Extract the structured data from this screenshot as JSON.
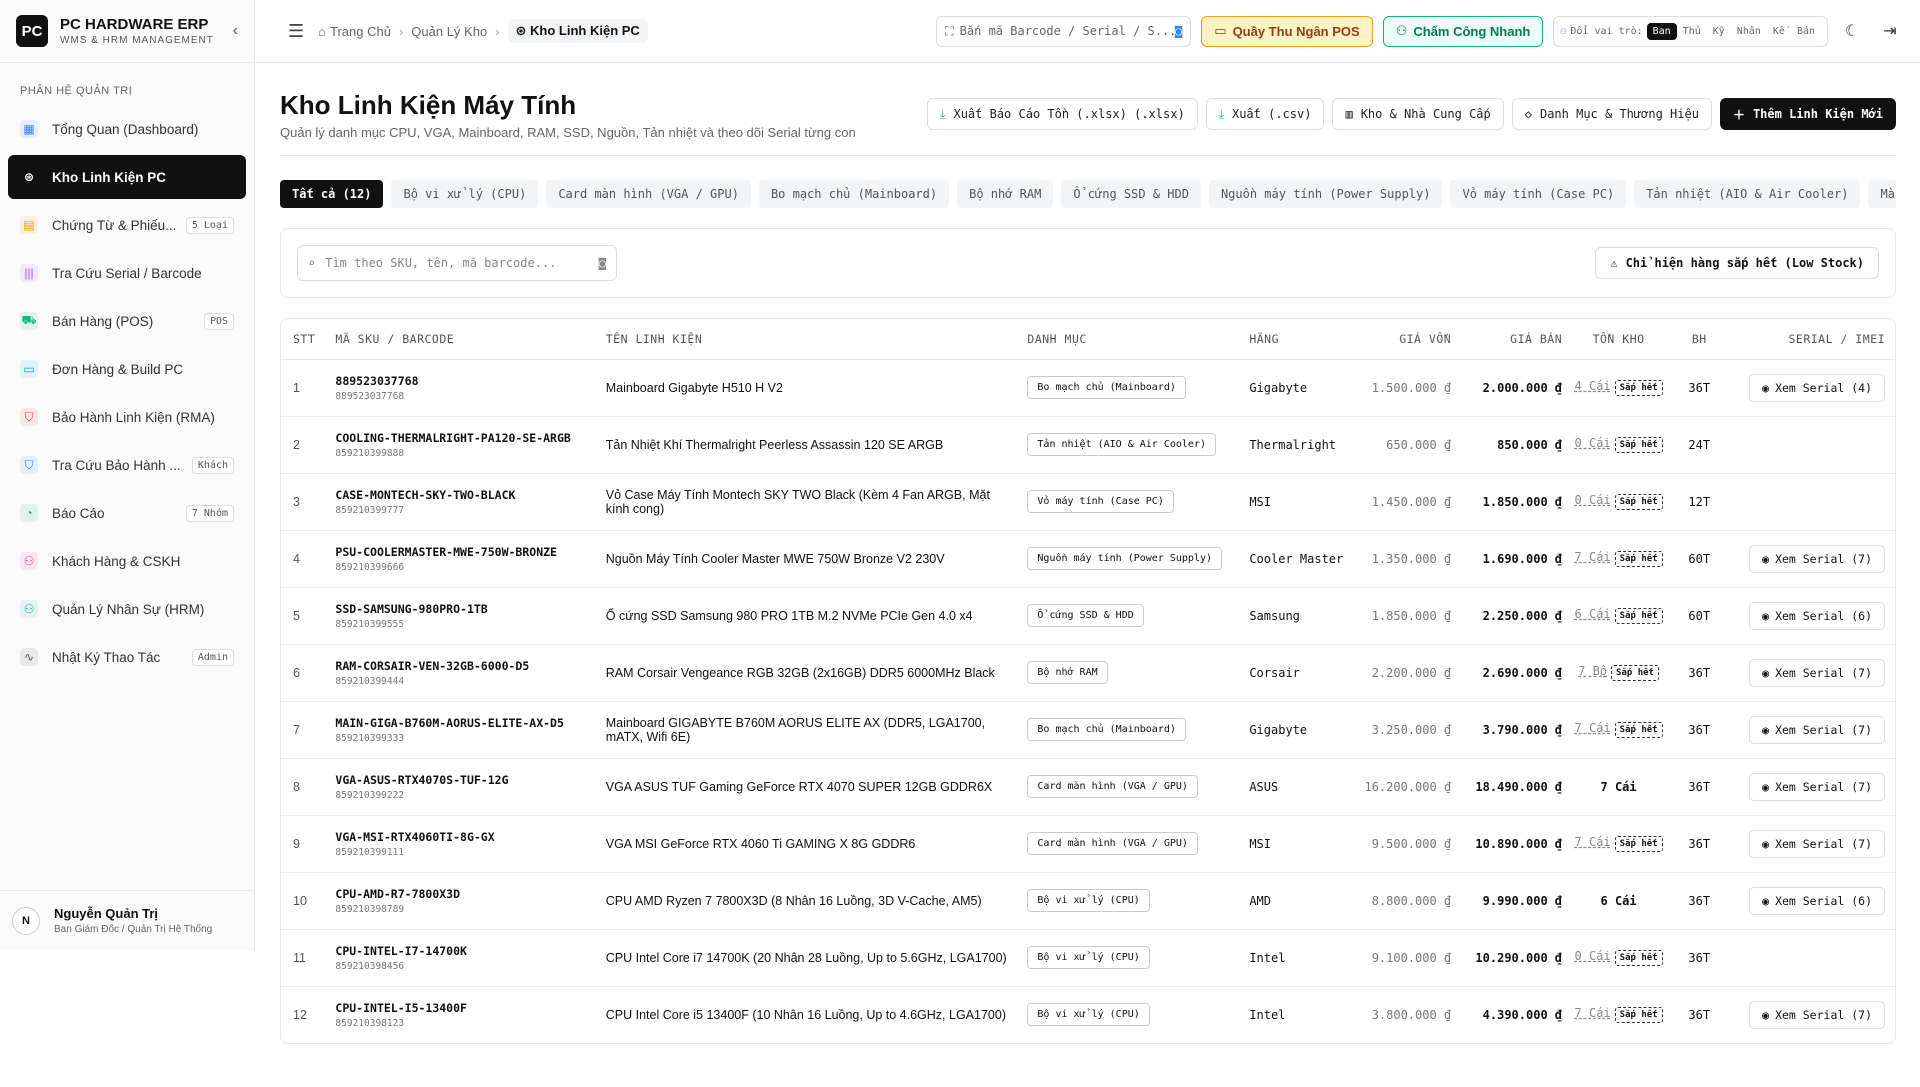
{
  "brand": {
    "logo": "PC",
    "name": "PC HARDWARE ERP",
    "sub": "WMS & HRM MANAGEMENT"
  },
  "sidebar": {
    "section": "PHÂN HỆ QUẢN TRỊ",
    "items": [
      {
        "label": "Tổng Quan (Dashboard)",
        "icon": "▦",
        "color": "#3b82f6",
        "badge": ""
      },
      {
        "label": "Kho Linh Kiện PC",
        "icon": "⊛",
        "color": "#ffffff",
        "badge": ""
      },
      {
        "label": "Chứng Từ & Phiếu...",
        "icon": "▤",
        "color": "#f59e0b",
        "badge": "5 Loại"
      },
      {
        "label": "Tra Cứu Serial / Barcode",
        "icon": "|||",
        "color": "#a855f7",
        "badge": ""
      },
      {
        "label": "Bán Hàng (POS)",
        "icon": "⛟",
        "color": "#10b981",
        "badge": "POS"
      },
      {
        "label": "Đơn Hàng & Build PC",
        "icon": "▭",
        "color": "#06b6d4",
        "badge": ""
      },
      {
        "label": "Bảo Hành Linh Kiện (RMA)",
        "icon": "⛉",
        "color": "#ef4444",
        "badge": ""
      },
      {
        "label": "Tra Cứu Bảo Hành ...",
        "icon": "⛉",
        "color": "#3b82f6",
        "badge": "Khách"
      },
      {
        "label": "Báo Cáo",
        "icon": "◔",
        "color": "#10b981",
        "badge": "7 Nhóm"
      },
      {
        "label": "Khách Hàng & CSKH",
        "icon": "⚇",
        "color": "#ec4899",
        "badge": ""
      },
      {
        "label": "Quản Lý Nhân Sự (HRM)",
        "icon": "⚇",
        "color": "#14b8a6",
        "badge": ""
      },
      {
        "label": "Nhật Ký Thao Tác",
        "icon": "∿",
        "color": "#555555",
        "badge": "Admin"
      }
    ]
  },
  "user": {
    "initial": "N",
    "name": "Nguyễn Quản Trị",
    "role": "Ban Giám Đốc / Quản Trị Hệ Thống"
  },
  "topbar": {
    "breadcrumb": [
      "Trang Chủ",
      "Quản Lý Kho",
      "Kho Linh Kiện PC"
    ],
    "barcode_placeholder": "Bắn mã Barcode / Serial / S...",
    "pos_label": "Quầy Thu Ngân POS",
    "attendance_label": "Chấm Công Nhanh",
    "role_label": "Đổi vai trò:",
    "roles": [
      "Ban",
      "Thủ",
      "Kỹ",
      "Nhân",
      "Kế",
      "Bán"
    ]
  },
  "page": {
    "title": "Kho Linh Kiện Máy Tính",
    "subtitle": "Quản lý danh mục CPU, VGA, Mainboard, RAM, SSD, Nguồn, Tản nhiệt và theo dõi Serial từng con",
    "actions": [
      "Xuất Báo Cáo Tồn (.xlsx) (.xlsx)",
      "Xuất (.csv)",
      "Kho & Nhà Cung Cấp",
      "Danh Mục & Thương Hiệu",
      "Thêm Linh Kiện Mới"
    ]
  },
  "tabs": [
    "Tất cả (12)",
    "Bộ vi xử lý (CPU)",
    "Card màn hình (VGA / GPU)",
    "Bo mạch chủ (Mainboard)",
    "Bộ nhớ RAM",
    "Ổ cứng SSD & HDD",
    "Nguồn máy tính (Power Supply)",
    "Vỏ máy tính (Case PC)",
    "Tản nhiệt (AIO & Air Cooler)",
    "Màn hình"
  ],
  "filter": {
    "search_placeholder": "Tìm theo SKU, tên, mã barcode...",
    "low_stock_label": "Chỉ hiện hàng sắp hết (Low Stock)"
  },
  "table": {
    "headers": [
      "STT",
      "MÃ SKU / BARCODE",
      "TÊN LINH KIỆN",
      "DANH MỤC",
      "HÃNG",
      "GIÁ VỐN",
      "GIÁ BÁN",
      "TỒN KHO",
      "BH",
      "SERIAL / IMEI"
    ],
    "low_tag": "Sắp hết",
    "rows": [
      {
        "stt": "1",
        "sku": "889523037768",
        "barcode": "889523037768",
        "name": "Mainboard Gigabyte H510 H V2",
        "cat": "Bo mạch chủ (Mainboard)",
        "brand": "Gigabyte",
        "cost": "1.500.000 ₫",
        "price": "2.000.000 ₫",
        "stock": "4 Cái",
        "low": true,
        "bh": "36T",
        "serial": "Xem Serial (4)"
      },
      {
        "stt": "2",
        "sku": "COOLING-THERMALRIGHT-PA120-SE-ARGB",
        "barcode": "859210399888",
        "name": "Tản Nhiệt Khí Thermalright Peerless Assassin 120 SE ARGB",
        "cat": "Tản nhiệt (AIO & Air Cooler)",
        "brand": "Thermalright",
        "cost": "650.000 ₫",
        "price": "850.000 ₫",
        "stock": "0 Cái",
        "low": true,
        "bh": "24T",
        "serial": ""
      },
      {
        "stt": "3",
        "sku": "CASE-MONTECH-SKY-TWO-BLACK",
        "barcode": "859210399777",
        "name": "Vỏ Case Máy Tính Montech SKY TWO Black (Kèm 4 Fan ARGB, Mặt kính cong)",
        "cat": "Vỏ máy tính (Case PC)",
        "brand": "MSI",
        "cost": "1.450.000 ₫",
        "price": "1.850.000 ₫",
        "stock": "0 Cái",
        "low": true,
        "bh": "12T",
        "serial": ""
      },
      {
        "stt": "4",
        "sku": "PSU-COOLERMASTER-MWE-750W-BRONZE",
        "barcode": "859210399666",
        "name": "Nguồn Máy Tính Cooler Master MWE 750W Bronze V2 230V",
        "cat": "Nguồn máy tính (Power Supply)",
        "brand": "Cooler Master",
        "cost": "1.350.000 ₫",
        "price": "1.690.000 ₫",
        "stock": "7 Cái",
        "low": true,
        "bh": "60T",
        "serial": "Xem Serial (7)"
      },
      {
        "stt": "5",
        "sku": "SSD-SAMSUNG-980PRO-1TB",
        "barcode": "859210399555",
        "name": "Ổ cứng SSD Samsung 980 PRO 1TB M.2 NVMe PCIe Gen 4.0 x4",
        "cat": "Ổ cứng SSD & HDD",
        "brand": "Samsung",
        "cost": "1.850.000 ₫",
        "price": "2.250.000 ₫",
        "stock": "6 Cái",
        "low": true,
        "bh": "60T",
        "serial": "Xem Serial (6)"
      },
      {
        "stt": "6",
        "sku": "RAM-CORSAIR-VEN-32GB-6000-D5",
        "barcode": "859210399444",
        "name": "RAM Corsair Vengeance RGB 32GB (2x16GB) DDR5 6000MHz Black",
        "cat": "Bộ nhớ RAM",
        "brand": "Corsair",
        "cost": "2.200.000 ₫",
        "price": "2.690.000 ₫",
        "stock": "7 Bộ",
        "low": true,
        "bh": "36T",
        "serial": "Xem Serial (7)"
      },
      {
        "stt": "7",
        "sku": "MAIN-GIGA-B760M-AORUS-ELITE-AX-D5",
        "barcode": "859210399333",
        "name": "Mainboard GIGABYTE B760M AORUS ELITE AX (DDR5, LGA1700, mATX, Wifi 6E)",
        "cat": "Bo mạch chủ (Mainboard)",
        "brand": "Gigabyte",
        "cost": "3.250.000 ₫",
        "price": "3.790.000 ₫",
        "stock": "7 Cái",
        "low": true,
        "bh": "36T",
        "serial": "Xem Serial (7)"
      },
      {
        "stt": "8",
        "sku": "VGA-ASUS-RTX4070S-TUF-12G",
        "barcode": "859210399222",
        "name": "VGA ASUS TUF Gaming GeForce RTX 4070 SUPER 12GB GDDR6X",
        "cat": "Card màn hình (VGA / GPU)",
        "brand": "ASUS",
        "cost": "16.200.000 ₫",
        "price": "18.490.000 ₫",
        "stock": "7 Cái",
        "low": false,
        "bh": "36T",
        "serial": "Xem Serial (7)"
      },
      {
        "stt": "9",
        "sku": "VGA-MSI-RTX4060TI-8G-GX",
        "barcode": "859210399111",
        "name": "VGA MSI GeForce RTX 4060 Ti GAMING X 8G GDDR6",
        "cat": "Card màn hình (VGA / GPU)",
        "brand": "MSI",
        "cost": "9.500.000 ₫",
        "price": "10.890.000 ₫",
        "stock": "7 Cái",
        "low": true,
        "bh": "36T",
        "serial": "Xem Serial (7)"
      },
      {
        "stt": "10",
        "sku": "CPU-AMD-R7-7800X3D",
        "barcode": "859210398789",
        "name": "CPU AMD Ryzen 7 7800X3D (8 Nhân 16 Luồng, 3D V-Cache, AM5)",
        "cat": "Bộ vi xử lý (CPU)",
        "brand": "AMD",
        "cost": "8.800.000 ₫",
        "price": "9.990.000 ₫",
        "stock": "6 Cái",
        "low": false,
        "bh": "36T",
        "serial": "Xem Serial (6)"
      },
      {
        "stt": "11",
        "sku": "CPU-INTEL-I7-14700K",
        "barcode": "859210398456",
        "name": "CPU Intel Core i7 14700K (20 Nhân 28 Luồng, Up to 5.6GHz, LGA1700)",
        "cat": "Bộ vi xử lý (CPU)",
        "brand": "Intel",
        "cost": "9.100.000 ₫",
        "price": "10.290.000 ₫",
        "stock": "0 Cái",
        "low": true,
        "bh": "36T",
        "serial": ""
      },
      {
        "stt": "12",
        "sku": "CPU-INTEL-I5-13400F",
        "barcode": "859210398123",
        "name": "CPU Intel Core i5 13400F (10 Nhân 16 Luồng, Up to 4.6GHz, LGA1700)",
        "cat": "Bộ vi xử lý (CPU)",
        "brand": "Intel",
        "cost": "3.800.000 ₫",
        "price": "4.390.000 ₫",
        "stock": "7 Cái",
        "low": true,
        "bh": "36T",
        "serial": "Xem Serial (7)"
      }
    ]
  }
}
